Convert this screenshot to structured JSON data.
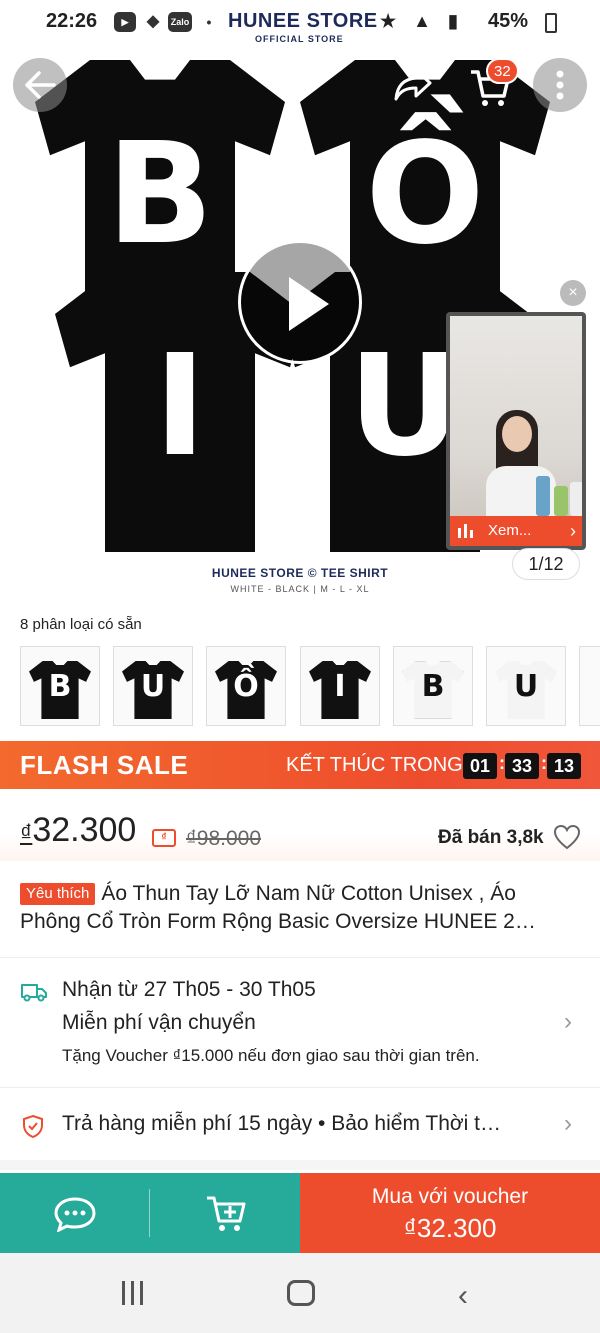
{
  "status_bar": {
    "time": "22:26",
    "battery": "45%",
    "brand": "HUNEE STORE",
    "brand_sub": "OFFICIAL STORE",
    "app_icons": [
      "Zalo"
    ]
  },
  "header": {
    "cart_count": "32",
    "icons": [
      "back-arrow-icon",
      "share-icon",
      "cart-icon",
      "more-icon"
    ]
  },
  "hero": {
    "letters": [
      "B",
      "Ồ",
      "I",
      "U"
    ],
    "caption": "HUNEE STORE © TEE SHIRT",
    "caption_sub": "WHITE - BLACK | M - L - XL",
    "image_counter": "1/12",
    "live_label": "Xem..."
  },
  "variants": {
    "label": "8 phân loại có sẵn",
    "items": [
      {
        "letter": "B",
        "color": "black"
      },
      {
        "letter": "U",
        "color": "black"
      },
      {
        "letter": "Ồ",
        "color": "black"
      },
      {
        "letter": "I",
        "color": "black"
      },
      {
        "letter": "B",
        "color": "white"
      },
      {
        "letter": "U",
        "color": "white"
      }
    ]
  },
  "flash_sale": {
    "title": "FLASH SALE",
    "ends_label": "KẾT THÚC TRONG",
    "hours": "01",
    "minutes": "33",
    "seconds": "13"
  },
  "price": {
    "currency": "₫",
    "current": "32.300",
    "old": "₫98.000",
    "sold": "Đã bán 3,8k"
  },
  "product": {
    "badge": "Yêu thích",
    "title": "Áo Thun Tay Lỡ Nam Nữ Cotton Unisex , Áo Phông Cổ Tròn Form Rộng Basic Oversize HUNEE 2…"
  },
  "shipping": {
    "delivery_window": "Nhận từ 27 Th05 - 30 Th05",
    "free_shipping": "Miễn phí vận chuyển",
    "voucher_note": "Tặng Voucher ₫15.000 nếu đơn giao sau thời gian trên."
  },
  "guarantee": {
    "text": "Trả hàng miễn phí 15 ngày  •  Bảo hiểm Thời t…"
  },
  "bottom_bar": {
    "buy_label": "Mua với voucher",
    "buy_price": "₫32.300"
  },
  "colors": {
    "accent": "#ee4d2d",
    "teal": "#26aa99"
  }
}
